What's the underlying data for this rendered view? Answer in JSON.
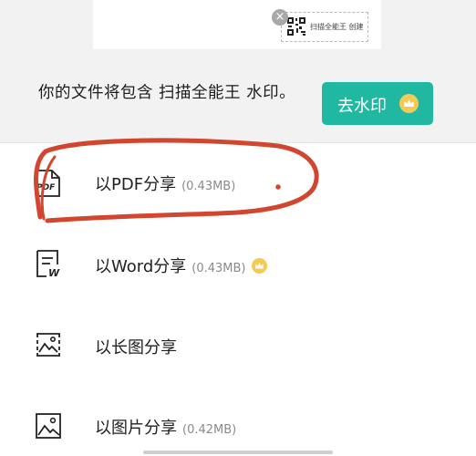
{
  "document_preview": {
    "watermark_text": "扫描全能王 创建",
    "close_icon": "close-icon",
    "qr_icon": "qr-code-icon"
  },
  "watermark_notice": {
    "text": "你的文件将包含 扫描全能王 水印。",
    "remove_button_label": "去水印",
    "premium_icon": "crown-icon",
    "brand_color": "#20b8a0"
  },
  "share_options": [
    {
      "label": "以PDF分享",
      "size": "(0.43MB)",
      "icon": "pdf-file-icon"
    },
    {
      "label": "以Word分享",
      "size": "(0.43MB)",
      "icon": "word-file-icon",
      "premium": true
    },
    {
      "label": "以长图分享",
      "size": "",
      "icon": "long-image-icon"
    },
    {
      "label": "以图片分享",
      "size": "(0.42MB)",
      "icon": "image-icon"
    }
  ],
  "annotation": {
    "color": "#d2452f"
  }
}
